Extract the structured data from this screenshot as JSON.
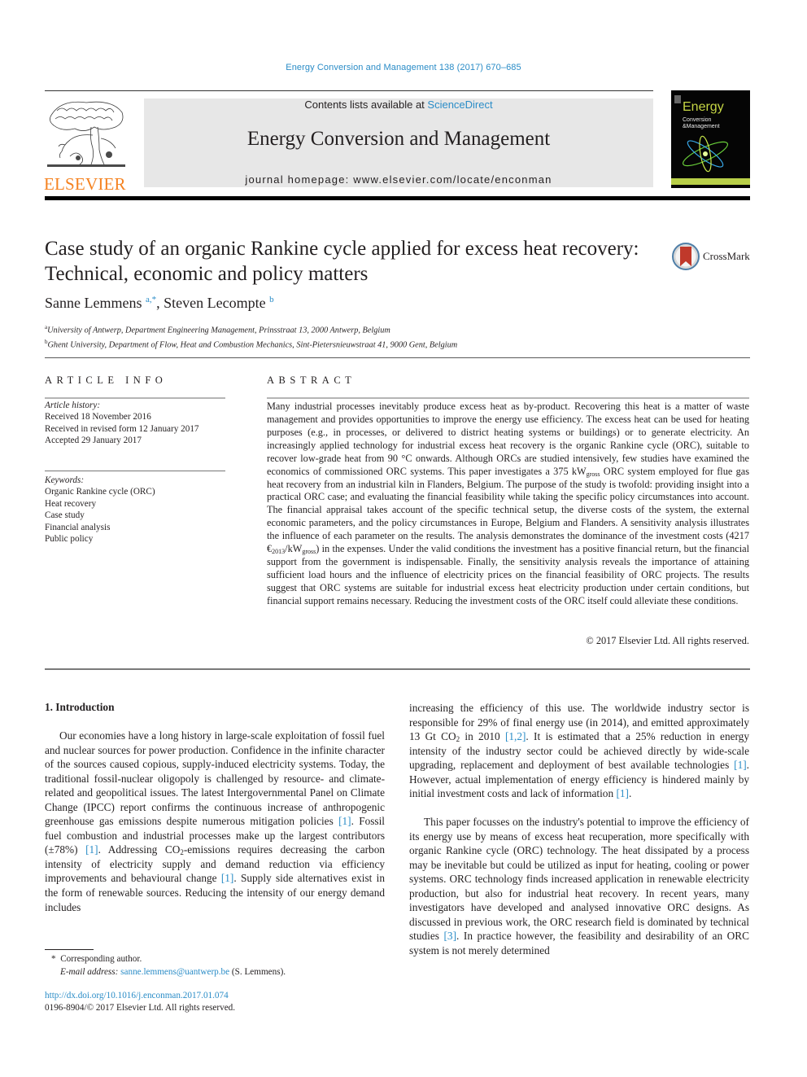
{
  "header": {
    "citation": "Energy Conversion and Management 138 (2017) 670–685",
    "contents_prefix": "Contents lists available at ",
    "sciencedirect_link": "ScienceDirect",
    "journal_name": "Energy Conversion and Management",
    "homepage": "journal homepage: www.elsevier.com/locate/enconman",
    "publisher_logo_text": "ELSEVIER",
    "cover": {
      "title": "Energy",
      "subtitle_line1": "Conversion",
      "subtitle_line2": "&Management"
    },
    "colors": {
      "link": "#2a8cc7",
      "elsevier_orange": "#f58220",
      "masthead_bg": "#e7e7e7"
    }
  },
  "article": {
    "title": "Case study of an organic Rankine cycle applied for excess heat recovery: Technical, economic and policy matters",
    "crossmark_label": "CrossMark",
    "authors": [
      {
        "name": "Sanne Lemmens",
        "marks": "a,*"
      },
      {
        "name": "Steven Lecompte",
        "marks": "b"
      }
    ],
    "author_separator": ", ",
    "affiliations": [
      {
        "mark": "a",
        "text": "University of Antwerp, Department Engineering Management, Prinsstraat 13, 2000 Antwerp, Belgium"
      },
      {
        "mark": "b",
        "text": "Ghent University, Department of Flow, Heat and Combustion Mechanics, Sint-Pietersnieuwstraat 41, 9000 Gent, Belgium"
      }
    ]
  },
  "article_info": {
    "heading": "ARTICLE INFO",
    "history_label": "Article history:",
    "history": [
      "Received 18 November 2016",
      "Received in revised form 12 January 2017",
      "Accepted 29 January 2017"
    ],
    "keywords_label": "Keywords:",
    "keywords": [
      "Organic Rankine cycle (ORC)",
      "Heat recovery",
      "Case study",
      "Financial analysis",
      "Public policy"
    ]
  },
  "abstract": {
    "heading": "ABSTRACT",
    "part1": "Many industrial processes inevitably produce excess heat as by-product. Recovering this heat is a matter of waste management and provides opportunities to improve the energy use efficiency. The excess heat can be used for heating purposes (e.g., in processes, or delivered to district heating systems or buildings) or to generate electricity. An increasingly applied technology for industrial excess heat recovery is the organic Rankine cycle (ORC), suitable to recover low-grade heat from 90 °C onwards. Although ORCs are studied intensively, few studies have examined the economics of commissioned ORC systems. This paper investigates a 375 kW",
    "sub1": "gross",
    "part2": " ORC system employed for flue gas heat recovery from an industrial kiln in Flanders, Belgium. The purpose of the study is twofold: providing insight into a practical ORC case; and evaluating the financial feasibility while taking the specific policy circumstances into account. The finan­cial appraisal takes account of the specific technical setup, the diverse costs of the system, the external economic parameters, and the policy circumstances in Europe, Belgium and Flanders. A sensitivity anal­ysis illustrates the influence of each parameter on the results. The analysis demonstrates the dominance of the investment costs (4217 €",
    "sub2": "2013",
    "part3": "/kW",
    "sub3": "gross",
    "part4": ") in the expenses. Under the valid conditions the investment has a positive financial return, but the financial support from the government is indispensable. Finally, the sensitivity analysis reveals the importance of attaining sufficient load hours and the influence of elec­tricity prices on the financial feasibility of ORC projects. The results suggest that ORC systems are suitable for industrial excess heat electricity production under certain conditions, but financial support remains necessary. Reducing the investment costs of the ORC itself could alleviate these conditions.",
    "copyright": "© 2017 Elsevier Ltd. All rights reserved."
  },
  "body": {
    "section_heading": "1. Introduction",
    "col1": {
      "t1": "Our economies have a long history in large-scale exploitation of fossil fuel and nuclear sources for power production. Confidence in the infinite character of the sources caused copious, supply-induced electricity systems. Today, the traditional fossil-nuclear oligopoly is challenged by resource- and climate-related and geopolitical issues. The latest Intergovernmental Panel on Climate Change (IPCC) report confirms the continuous increase of anthro­pogenic greenhouse gas emissions despite numerous mitigation policies ",
      "r1": "[1]",
      "t2": ". Fossil fuel combustion and industrial processes make up the largest contributors (±78%) ",
      "r2": "[1]",
      "t3": ". Addressing CO",
      "s1": "2",
      "t4": "-emissions requires decreasing the carbon intensity of electricity supply and demand reduction via efficiency improvements and behavioural change ",
      "r3": "[1]",
      "t5": ". Supply side alternatives exist in the form of renewable sources. Reducing the intensity of our energy demand includes"
    },
    "col2": {
      "p1": {
        "t1": "increasing the efficiency of this use. The worldwide industry sector is responsible for 29% of final energy use (in 2014), and emitted approximately 13 Gt CO",
        "s1": "2",
        "t2": " in 2010 ",
        "r1": "[1,2]",
        "t3": ". It is estimated that a 25% reduction in energy intensity of the industry sector could be achieved directly by wide-scale upgrading, replacement and deployment of best available technologies ",
        "r2": "[1]",
        "t4": ". However, actual implementation of energy efficiency is hindered mainly by initial investment costs and lack of information ",
        "r3": "[1]",
        "t5": "."
      },
      "p2": {
        "t1": "This paper focusses on the industry's potential to improve the efficiency of its energy use by means of excess heat recuperation, more specifically with organic Rankine cycle (ORC) technology. The heat dissipated by a process may be inevitable but could be utilized as input for heating, cooling or power systems. ORC tech­nology finds increased application in renewable electricity produc­tion, but also for industrial heat recovery. In recent years, many investigators have developed and analysed innovative ORC designs. As discussed in previous work, the ORC research field is dominated by technical studies ",
        "r1": "[3]",
        "t2": ". In practice however, the feasi­bility and desirability of an ORC system is not merely determined"
      }
    }
  },
  "footnotes": {
    "corresponding_mark": "*",
    "corresponding_text": "Corresponding author.",
    "email_label": "E-mail address:",
    "email": "sanne.lemmens@uantwerp.be",
    "email_suffix": " (S. Lemmens).",
    "doi_link": "http://dx.doi.org/10.1016/j.enconman.2017.01.074",
    "issn_line": "0196-8904/© 2017 Elsevier Ltd. All rights reserved."
  }
}
